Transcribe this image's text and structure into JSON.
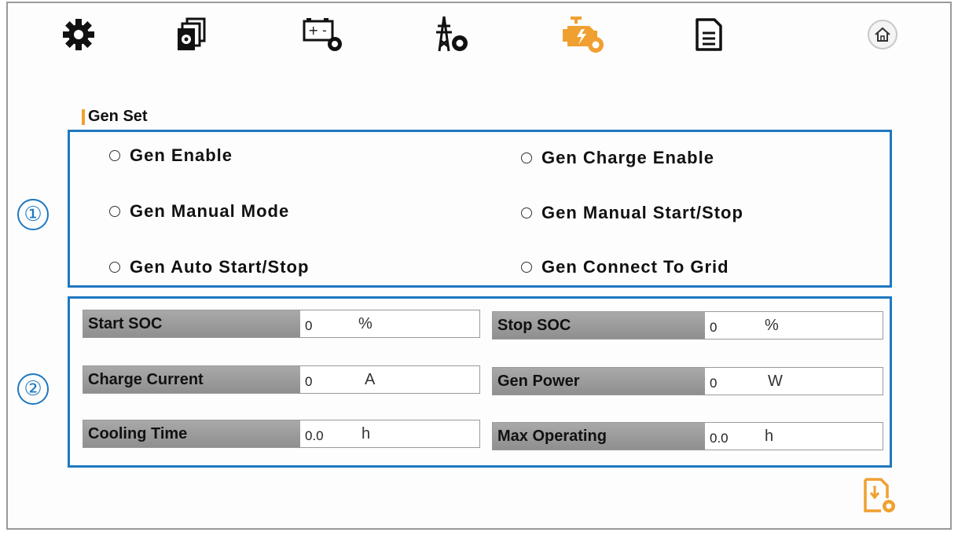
{
  "toolbar": {
    "icons": [
      "gear-icon",
      "system-setting-icon",
      "battery-setting-icon",
      "grid-setting-icon",
      "generator-setting-icon",
      "document-icon",
      "home-icon"
    ],
    "active_color": "#f0a030"
  },
  "section": {
    "title": "Gen Set"
  },
  "markers": {
    "one": "①",
    "two": "②"
  },
  "options": [
    {
      "label": "Gen Enable"
    },
    {
      "label": "Gen Charge Enable"
    },
    {
      "label": "Gen Manual Mode"
    },
    {
      "label": "Gen Manual Start/Stop"
    },
    {
      "label": "Gen Auto Start/Stop"
    },
    {
      "label": "Gen Connect To Grid"
    }
  ],
  "fields": [
    {
      "label": "Start SOC",
      "value": "0",
      "unit": "%"
    },
    {
      "label": "Stop SOC",
      "value": "0",
      "unit": "%"
    },
    {
      "label": "Charge Current",
      "value": "0",
      "unit": "A"
    },
    {
      "label": "Gen Power",
      "value": "0",
      "unit": "W"
    },
    {
      "label": "Cooling Time",
      "value": "0.0",
      "unit": "h"
    },
    {
      "label": "Max Operating",
      "value": "0.0",
      "unit": "h"
    }
  ],
  "colors": {
    "highlight": "#1f78c0",
    "accent": "#f0a030"
  }
}
